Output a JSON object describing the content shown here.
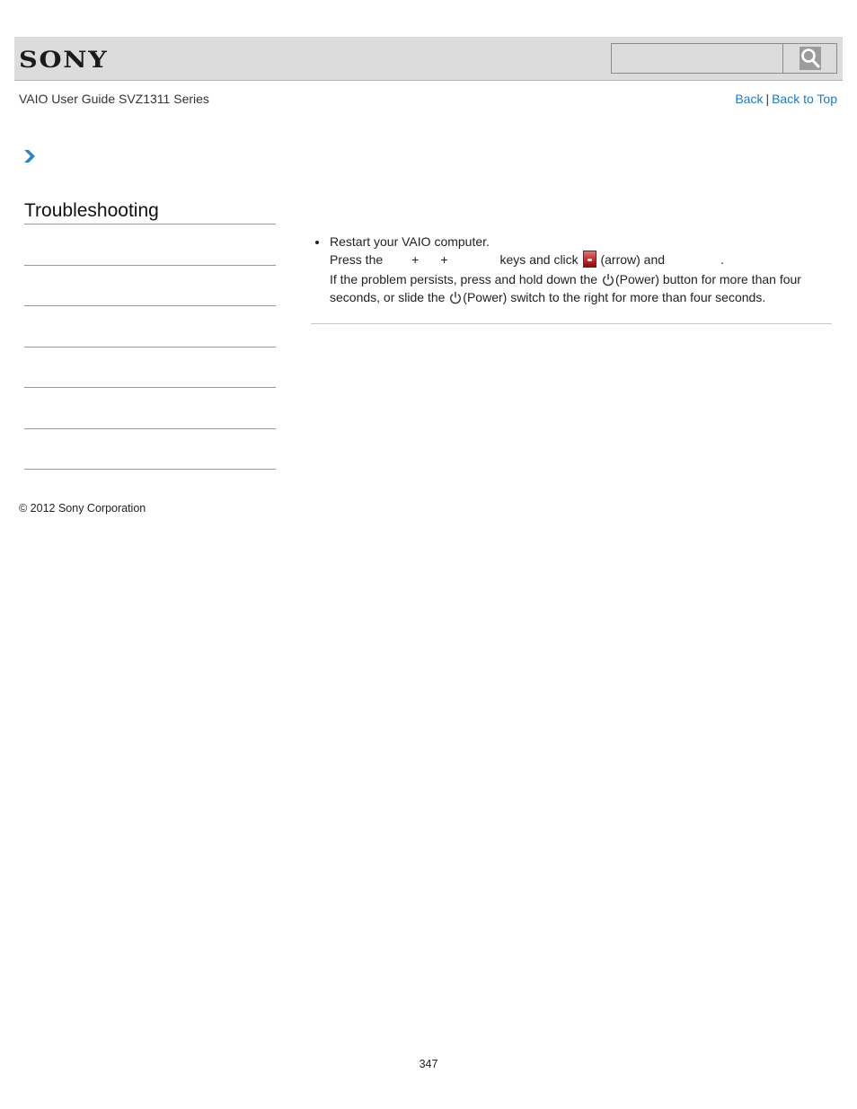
{
  "header": {
    "logo": "SONY",
    "search": {
      "placeholder": "",
      "value": ""
    },
    "search_button_icon": "magnifier-icon"
  },
  "nav": {
    "guide_title": "VAIO User Guide SVZ1311 Series",
    "back_label": "Back",
    "separator": "|",
    "back_to_top_label": "Back to Top",
    "breadcrumb_icon": "chevron-right-icon"
  },
  "sidebar": {
    "section_title": "Troubleshooting",
    "items": [
      {
        "label": ""
      },
      {
        "label": ""
      },
      {
        "label": ""
      },
      {
        "label": ""
      },
      {
        "label": ""
      },
      {
        "label": ""
      }
    ]
  },
  "content": {
    "bullet_title": "Restart your VAIO computer.",
    "press_the": "Press the",
    "plus1": "+",
    "plus2": "+",
    "keys_and_click": "keys and click",
    "arrow_label": "(arrow) and",
    "period": ".",
    "persist_part1": "If the problem persists, press and hold down the",
    "persist_part2": "(Power) button for more than four",
    "persist_part3": "seconds, or slide the",
    "persist_part4": "(Power) switch to the right for more than four seconds.",
    "icons": {
      "arrow": "arrow-button-icon",
      "power": "power-icon"
    }
  },
  "footer": {
    "copyright": "© 2012 Sony Corporation",
    "page_number": "347"
  }
}
